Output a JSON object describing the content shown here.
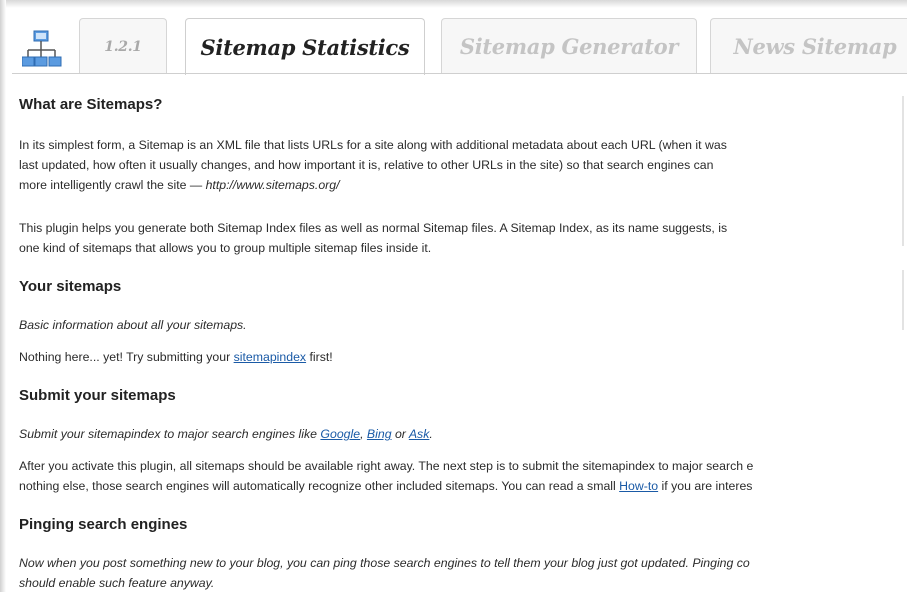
{
  "header": {
    "tabs": [
      {
        "label": "1.2.1"
      },
      {
        "label": "Sitemap Statistics"
      },
      {
        "label": "Sitemap Generator"
      },
      {
        "label": "News Sitemap"
      }
    ],
    "app_icon": "sitemap-icon"
  },
  "sections": {
    "what": {
      "title": "What are Sitemaps?",
      "p1_line1": "In its simplest form, a Sitemap is an XML file that lists URLs for a site along with additional metadata about each URL (when it was",
      "p1_line2": "last updated, how often it usually changes, and how important it is, relative to other URLs in the site) so that search engines can",
      "p1_line3_text": "more intelligently crawl the site — ",
      "p1_line3_link": "http://www.sitemaps.org/",
      "p2_line1": "This plugin helps you generate both Sitemap Index files as well as normal Sitemap files. A Sitemap Index, as its name suggests, is",
      "p2_line2": "one kind of sitemaps that allows you to group multiple sitemap files inside it."
    },
    "yours": {
      "title": "Your sitemaps",
      "subtitle": "Basic information about all your sitemaps.",
      "empty_before": "Nothing here... yet! Try submitting your ",
      "empty_link": "sitemapindex",
      "empty_after": " first!"
    },
    "submit": {
      "title": "Submit your sitemaps",
      "intro_before": "Submit your sitemapindex to major search engines like ",
      "google": "Google",
      "comma": ", ",
      "bing": "Bing",
      "or": " or ",
      "ask": "Ask",
      "dot": ".",
      "p_line1": "After you activate this plugin, all sitemaps should be available right away. The next step is to submit the sitemapindex to major search e",
      "p_line2_before": "nothing else, those search engines will automatically recognize other included sitemaps. You can read a small ",
      "howto": "How-to",
      "p_line2_after": " if you are interes"
    },
    "ping": {
      "title": "Pinging search engines",
      "line1": "Now when you post something new to your blog, you can ping those search engines to tell them your blog just got updated. Pinging co",
      "line2": "should enable such feature anyway."
    }
  },
  "colors": {
    "link": "#1a5aa6",
    "tab_inactive_text": "#c4c4c4",
    "icon_blue": "#4a8fd0"
  }
}
